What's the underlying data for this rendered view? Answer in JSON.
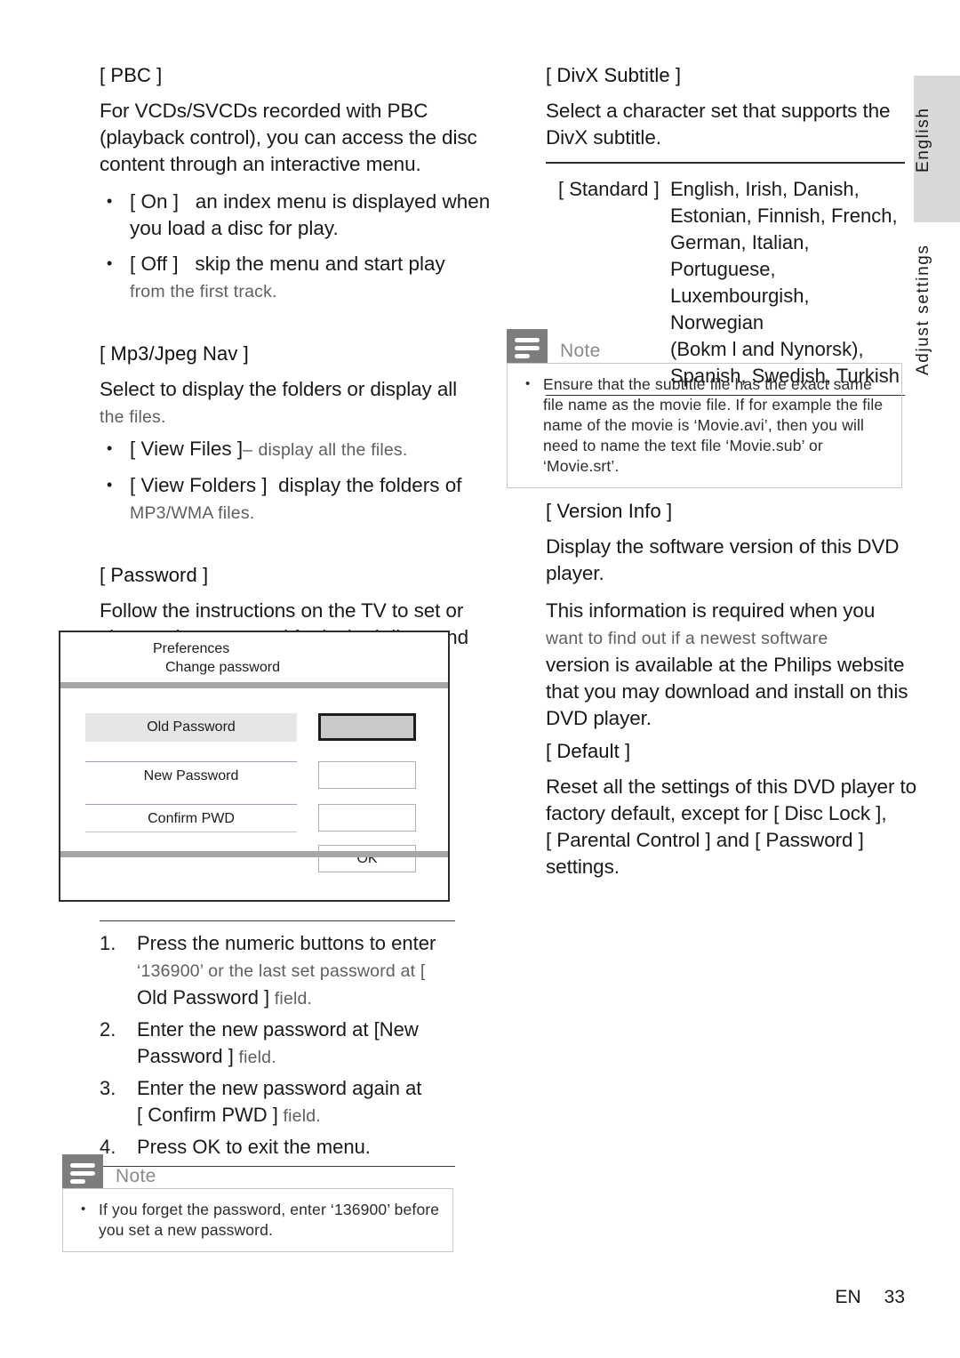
{
  "page": {
    "footer_locale": "EN",
    "footer_number": "33"
  },
  "side_tabs": {
    "language": "English",
    "chapter": "Adjust settings"
  },
  "left_column": {
    "pbc": {
      "heading": "[ PBC ]",
      "body": "For VCDs/SVCDs recorded with PBC (playback control), you can access the disc content through an interactive menu.",
      "options": [
        {
          "label": "[ On ]",
          "text": "an index menu is displayed when you load a disc for play.",
          "soft": ""
        },
        {
          "label": "[ Off ]",
          "text": "skip the menu and start play",
          "soft": "from the first track."
        }
      ]
    },
    "mp3_jpeg_nav": {
      "heading": "[ Mp3/Jpeg Nav ]",
      "body_main": "Select to display the folders or display all",
      "body_soft": "the files.",
      "options": [
        {
          "label": "[ View Files ]",
          "dash": "–",
          "soft": "display all the files."
        },
        {
          "label": "[ View Folders ]",
          "text": "display the folders of",
          "soft": "MP3/WMA files."
        }
      ]
    },
    "password": {
      "heading": "[ Password ]",
      "body": "Follow the instructions on the TV to set or change the password for locked discs and play restricted DVDs."
    },
    "osd_dialog": {
      "title_line1": "Preferences",
      "title_line2": "Change password",
      "rows": [
        {
          "label": "Old Password",
          "field_value": "",
          "state": "focused"
        },
        {
          "label": "New Password",
          "field_value": "",
          "state": "normal"
        },
        {
          "label": "Confirm PWD",
          "field_value": "",
          "state": "normal"
        }
      ],
      "ok_button": "OK"
    },
    "steps": [
      {
        "num": "1.",
        "main": "Press the ",
        "bold": "numeric buttons",
        "main2": " to enter",
        "soft": "‘136900’ or the last set password at [",
        "line3_main": "Old Password ]",
        "line3_soft": " field."
      },
      {
        "num": "2.",
        "main": "Enter the new password at [",
        "main2": "New",
        "line2_main": "Password ]",
        "line2_soft": " field."
      },
      {
        "num": "3.",
        "main": "Enter the new password again at",
        "line2_main": "[ Confirm PWD ]",
        "line2_soft": " field."
      },
      {
        "num": "4.",
        "main": "Press ",
        "bold": "OK",
        "main2": " to exit the menu."
      }
    ],
    "note": {
      "title": "Note",
      "items": [
        "If you forget the password, enter ‘136900’ before you set a new password."
      ]
    }
  },
  "right_column": {
    "divx_subtitle": {
      "heading": "[ DivX Subtitle ]",
      "body": "Select a character set that supports the DivX subtitle.",
      "table": {
        "key": "[ Standard ]",
        "value": "English, Irish, Danish,\nEstonian, Finnish, French,\nGerman, Italian, Portuguese,\nLuxembourgish, Norwegian\n(Bokm l and Nynorsk),\nSpanish, Swedish, Turkish"
      }
    },
    "note": {
      "title": "Note",
      "items": [
        "Ensure that the subtitle file has the exact same file name as the movie file. If for example the file name of the movie is ‘Movie.avi’, then you will need to name the text file ‘Movie.sub’ or ‘Movie.srt’."
      ]
    },
    "version_info": {
      "heading": "[ Version Info ]",
      "body1": "Display the software version of this DVD player.",
      "body2_main": "This information is required when you",
      "body2_soft": "want to find out if a newest software",
      "body2_main2": "version is available at the Philips website that you may download and install on this DVD player."
    },
    "default_settings": {
      "heading": "[ Default ]",
      "line1": "Reset all the settings of this DVD player to",
      "line2": "factory default, except for [ Disc Lock ],",
      "line3": "[ Parental Control ] and [ Password ]",
      "line4": "settings."
    }
  }
}
